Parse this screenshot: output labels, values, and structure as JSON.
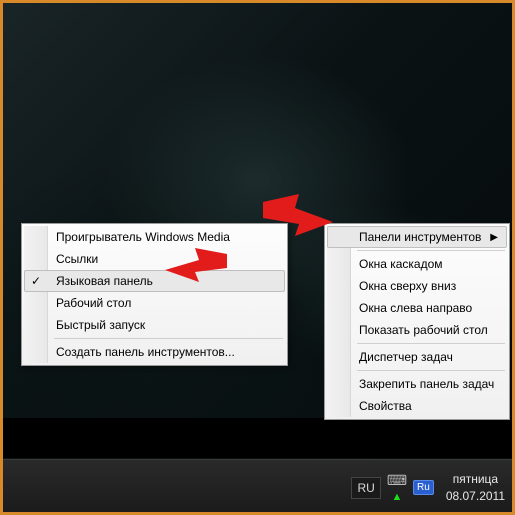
{
  "submenu": {
    "items": [
      {
        "label": "Проигрыватель Windows Media",
        "checked": false
      },
      {
        "label": "Ссылки",
        "checked": false
      },
      {
        "label": "Языковая панель",
        "checked": true,
        "highlighted": true
      },
      {
        "label": "Рабочий стол",
        "checked": false
      },
      {
        "label": "Быстрый запуск",
        "checked": false
      }
    ],
    "footer": "Создать панель инструментов..."
  },
  "mainmenu": {
    "toolbars": "Панели инструментов",
    "group1": [
      "Окна каскадом",
      "Окна сверху вниз",
      "Окна слева направо",
      "Показать рабочий стол"
    ],
    "taskmgr": "Диспетчер задач",
    "group2": [
      "Закрепить панель задач",
      "Свойства"
    ]
  },
  "taskbar": {
    "lang_indicator": "RU",
    "lang_badge": "Ru",
    "day": "пятница",
    "date": "08.07.2011"
  },
  "icons": {
    "check": "✓",
    "arrow_right": "▶",
    "keyboard": "⌨",
    "warning_triangle": "▲"
  }
}
